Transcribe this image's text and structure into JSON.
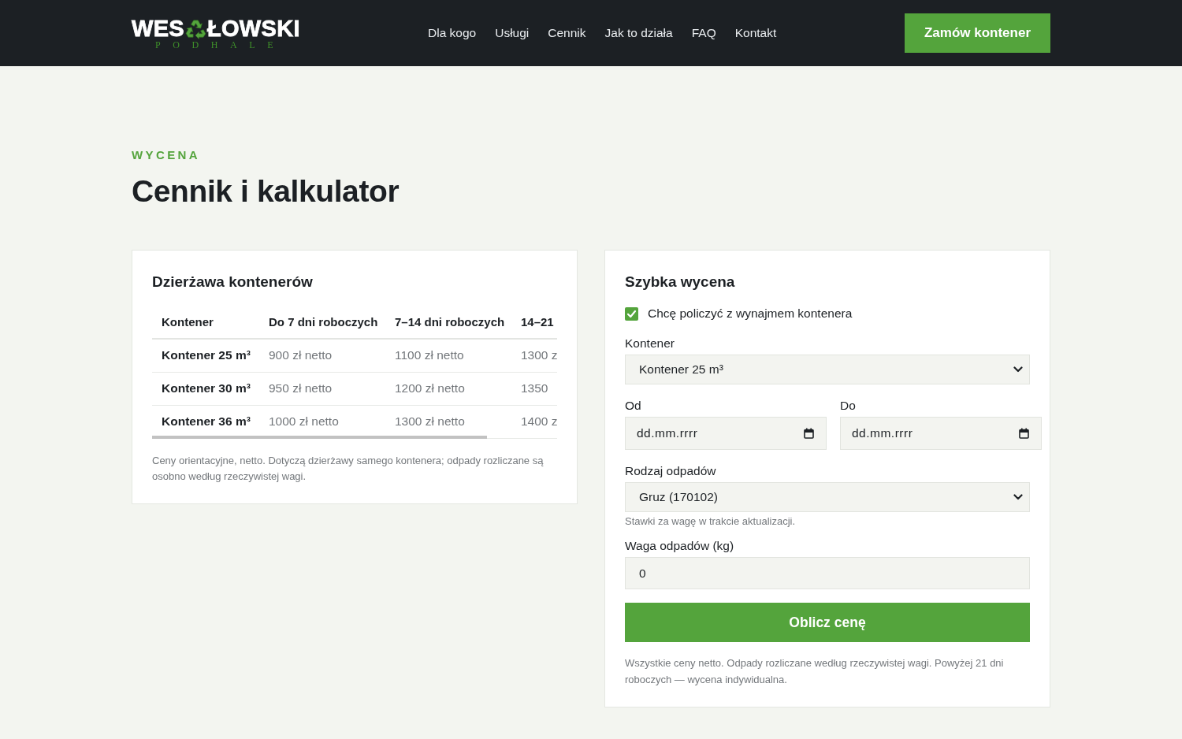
{
  "header": {
    "logo": {
      "word_start": "WES",
      "word_end": "ŁOWSKI",
      "tagline": "PODHALE"
    },
    "nav": [
      "Dla kogo",
      "Usługi",
      "Cennik",
      "Jak to działa",
      "FAQ",
      "Kontakt"
    ],
    "cta": "Zamów kontener"
  },
  "section": {
    "eyebrow": "WYCENA",
    "title": "Cennik i kalkulator"
  },
  "rental_card": {
    "title": "Dzierżawa kontenerów",
    "table": {
      "columns": [
        "Kontener",
        "Do 7 dni roboczych",
        "7–14 dni roboczych",
        "14–21"
      ],
      "rows": [
        [
          "Kontener 25 m³",
          "900 zł netto",
          "1100 zł netto",
          "1300 z"
        ],
        [
          "Kontener 30 m³",
          "950 zł netto",
          "1200 zł netto",
          "1350"
        ],
        [
          "Kontener 36 m³",
          "1000 zł netto",
          "1300 zł netto",
          "1400 z"
        ]
      ]
    },
    "note": "Ceny orientacyjne, netto. Dotyczą dzierżawy samego kontenera; odpady rozliczane są osobno według rzeczywistej wagi."
  },
  "quote_card": {
    "title": "Szybka wycena",
    "fields": [
      {
        "kind": "checkbox",
        "label": "Chcę policzyć z wynajmem kontenera",
        "checked": true
      },
      {
        "kind": "select",
        "label": "Kontener",
        "value": "Kontener 25 m³"
      },
      {
        "kind": "date_pair",
        "items": [
          {
            "label": "Od",
            "placeholder": "dd.mm.rrrr"
          },
          {
            "label": "Do",
            "placeholder": "dd.mm.rrrr"
          }
        ]
      },
      {
        "kind": "select",
        "label": "Rodzaj odpadów",
        "value": "Gruz (170102)",
        "hint": "Stawki za wagę w trakcie aktualizacji."
      },
      {
        "kind": "number",
        "label": "Waga odpadów (kg)",
        "value": "0"
      }
    ],
    "button": "Oblicz cenę",
    "note": "Wszystkie ceny netto. Odpady rozliczane według rzeczywistej wagi. Powyżej 21 dni roboczych — wycena indywidualna."
  }
}
